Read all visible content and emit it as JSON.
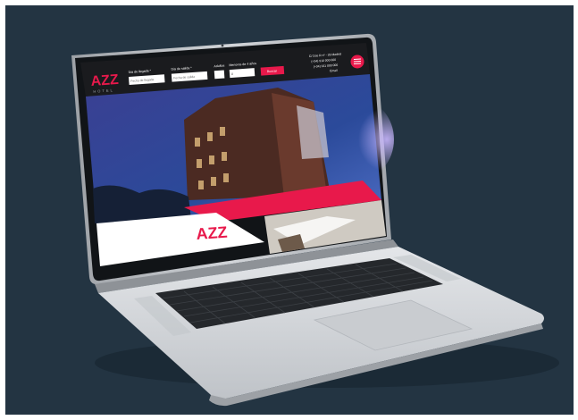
{
  "colors": {
    "background": "#233442",
    "accent": "#e8194b",
    "laptop_body": "#d3d6da",
    "bezel": "#111417",
    "keyboard": "#2a2d31"
  },
  "site": {
    "logo_text": "AZZ",
    "logo_subtext": "HOTEL",
    "arrival_label": "Dia de llegada *",
    "arrival_placeholder": "Fecha de llegada",
    "departure_label": "Dia de salida *",
    "departure_placeholder": "Fecha de salida",
    "adults_label": "Adultos",
    "children_label": "Menores de 4 años",
    "children_value": "0",
    "search_button": "Buscar",
    "contact_lines": [
      "C/ Dos R nº - 28 Madrid",
      "(+34) 910 000 000",
      "(+34) 911 000 000",
      "Email"
    ]
  },
  "icons": {
    "menu": "hamburger-menu-icon",
    "location": "location-pin-icon",
    "phone": "phone-icon",
    "mail": "mail-icon"
  }
}
